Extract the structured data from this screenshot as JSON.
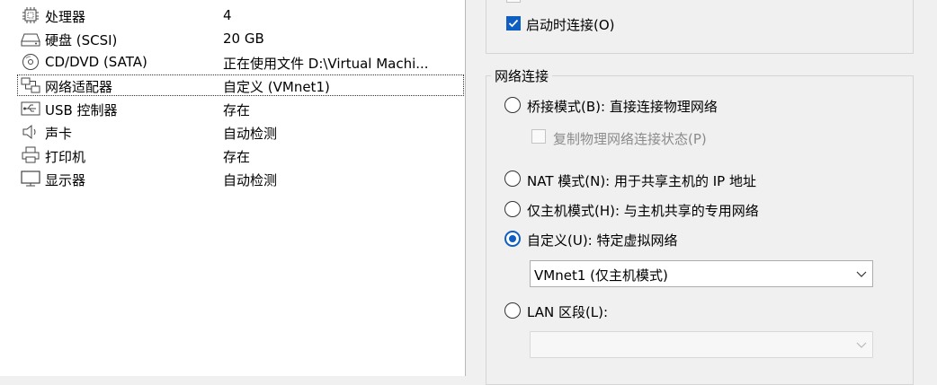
{
  "hardware": {
    "items": [
      {
        "icon": "cpu-icon",
        "name": "处理器",
        "summary": "4"
      },
      {
        "icon": "hard-disk-icon",
        "name": "硬盘 (SCSI)",
        "summary": "20 GB"
      },
      {
        "icon": "cd-dvd-icon",
        "name": "CD/DVD (SATA)",
        "summary": "正在使用文件 D:\\Virtual Machi..."
      },
      {
        "icon": "network-adapter-icon",
        "name": "网络适配器",
        "summary": "自定义 (VMnet1)"
      },
      {
        "icon": "usb-icon",
        "name": "USB 控制器",
        "summary": "存在"
      },
      {
        "icon": "speaker-icon",
        "name": "声卡",
        "summary": "自动检测"
      },
      {
        "icon": "printer-icon",
        "name": "打印机",
        "summary": "存在"
      },
      {
        "icon": "monitor-icon",
        "name": "显示器",
        "summary": "自动检测"
      }
    ]
  },
  "device_status": {
    "connect_at_power_on": {
      "label": "启动时连接(O)",
      "checked": true
    }
  },
  "network": {
    "group_title": "网络连接",
    "bridged": {
      "label": "桥接模式(B): 直接连接物理网络",
      "selected": false
    },
    "replicate_state": {
      "label": "复制物理网络连接状态(P)",
      "checked": false,
      "disabled": true
    },
    "nat": {
      "label": "NAT 模式(N): 用于共享主机的 IP 地址",
      "selected": false
    },
    "host_only": {
      "label": "仅主机模式(H): 与主机共享的专用网络",
      "selected": false
    },
    "custom": {
      "label": "自定义(U): 特定虚拟网络",
      "selected": true
    },
    "custom_select": {
      "value": "VMnet1 (仅主机模式)"
    },
    "lan_segment": {
      "label": "LAN 区段(L):",
      "selected": false
    },
    "lan_select": {
      "value": "",
      "disabled": true
    }
  },
  "colors": {
    "accent": "#0f5fc2",
    "disabled_text": "#8b8b8b"
  }
}
